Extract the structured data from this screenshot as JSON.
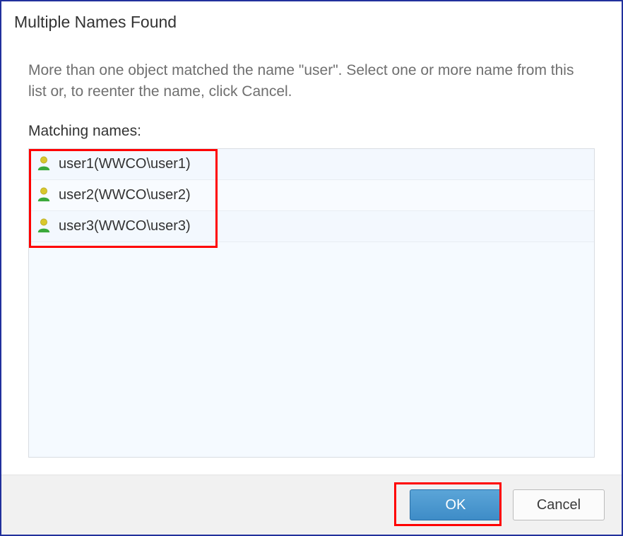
{
  "dialog": {
    "title": "Multiple Names Found",
    "instruction": "More than one object matched the name \"user\". Select one or more name from this list or, to reenter the name, click Cancel.",
    "list_label": "Matching names:",
    "items": [
      {
        "label": "user1(WWCO\\user1)"
      },
      {
        "label": "user2(WWCO\\user2)"
      },
      {
        "label": "user3(WWCO\\user3)"
      }
    ]
  },
  "footer": {
    "ok_label": "OK",
    "cancel_label": "Cancel"
  }
}
